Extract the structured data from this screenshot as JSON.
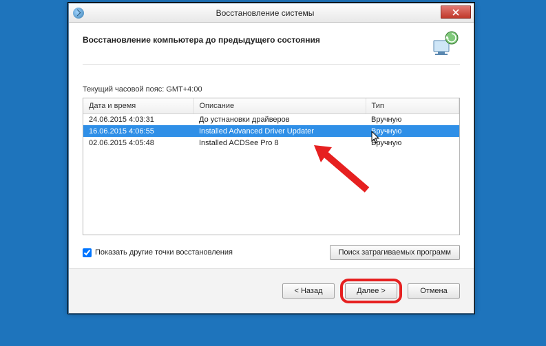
{
  "window": {
    "title": "Восстановление системы"
  },
  "header": {
    "subtitle": "Восстановление компьютера до предыдущего состояния"
  },
  "timezone_label": "Текущий часовой пояс: GMT+4:00",
  "table": {
    "columns": {
      "date": "Дата и время",
      "desc": "Описание",
      "type": "Тип"
    },
    "rows": [
      {
        "date": "24.06.2015 4:03:31",
        "desc": "До устнановки драйверов",
        "type": "Вручную",
        "selected": false
      },
      {
        "date": "16.06.2015 4:06:55",
        "desc": "Installed Advanced Driver Updater",
        "type": "Вручную",
        "selected": true
      },
      {
        "date": "02.06.2015 4:05:48",
        "desc": "Installed ACDSee Pro 8",
        "type": "Вручную",
        "selected": false
      }
    ]
  },
  "checkbox": {
    "label": "Показать другие точки восстановления",
    "checked": true
  },
  "buttons": {
    "affected": "Поиск затрагиваемых программ",
    "back": "< Назад",
    "next": "Далее >",
    "cancel": "Отмена"
  }
}
